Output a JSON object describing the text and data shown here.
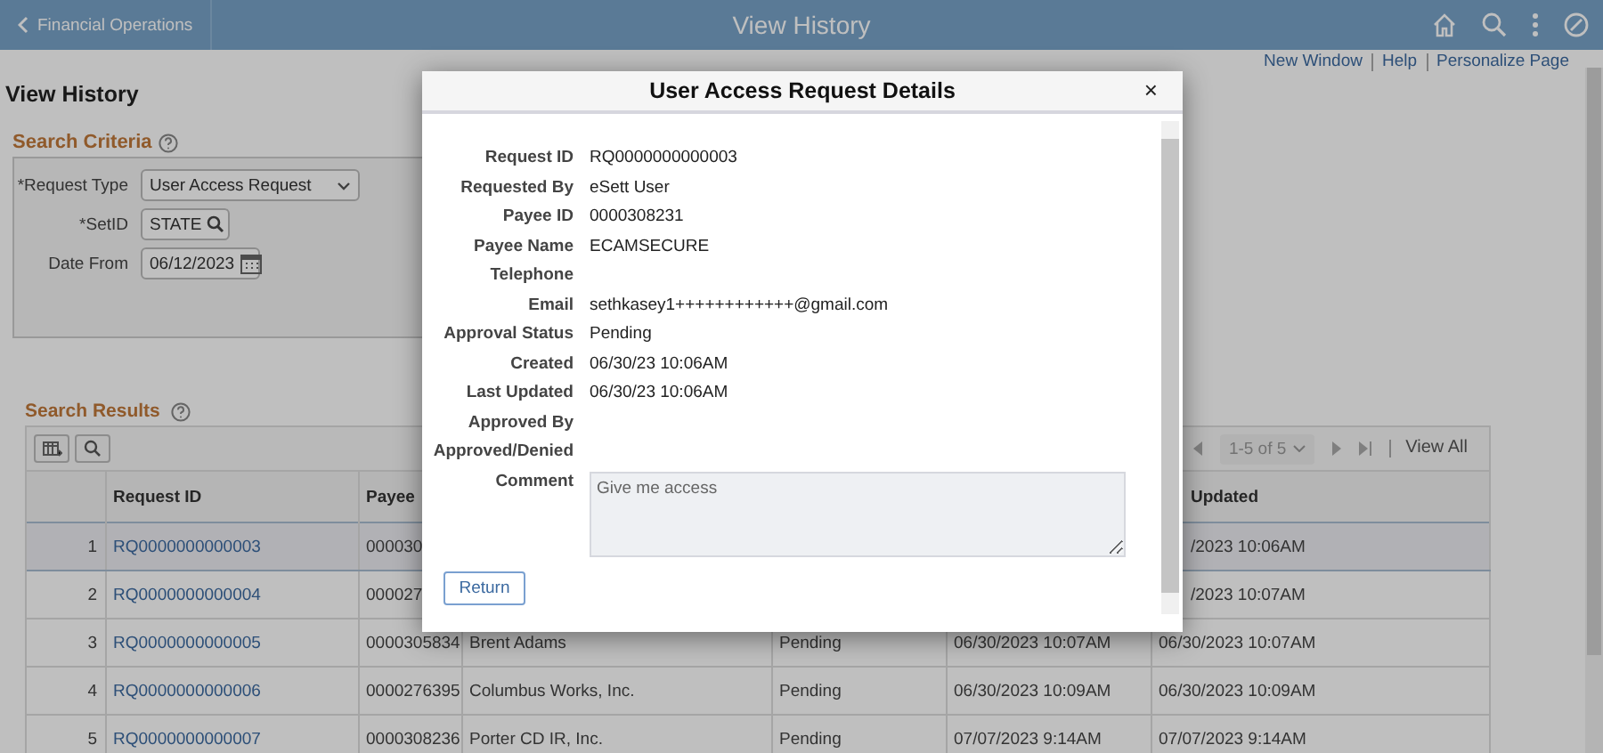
{
  "header": {
    "back_label": "Financial Operations",
    "title": "View History"
  },
  "top_links": [
    "New Window",
    "Help",
    "Personalize Page"
  ],
  "page_title": "View History",
  "search_criteria": {
    "title": "Search Criteria",
    "fields": [
      {
        "kind": "dropdown",
        "label": "*Request Type",
        "value": "User Access Request"
      },
      {
        "kind": "lookup",
        "label": "*SetID",
        "value": "STATE"
      },
      {
        "kind": "date",
        "label": "Date From",
        "value": "06/12/2023"
      }
    ]
  },
  "search_results": {
    "title": "Search Results",
    "pagination": "1-5 of 5",
    "view_all": "View All",
    "columns": [
      null,
      "Request ID",
      "Payee",
      null,
      null,
      null,
      "Updated"
    ],
    "rows": [
      {
        "selected": true,
        "cells": [
          "1",
          "RQ0000000000003",
          "000030",
          null,
          null,
          null,
          "/2023 10:06AM"
        ]
      },
      {
        "selected": false,
        "cells": [
          "2",
          "RQ0000000000004",
          "000027",
          null,
          null,
          null,
          "/2023 10:07AM"
        ]
      },
      {
        "selected": false,
        "cells": [
          "3",
          "RQ0000000000005",
          "0000305834",
          "Brent Adams",
          "Pending",
          "06/30/2023 10:07AM",
          "06/30/2023 10:07AM"
        ]
      },
      {
        "selected": false,
        "cells": [
          "4",
          "RQ0000000000006",
          "0000276395",
          "Columbus Works, Inc.",
          "Pending",
          "06/30/2023 10:09AM",
          "06/30/2023 10:09AM"
        ]
      },
      {
        "selected": false,
        "cells": [
          "5",
          "RQ0000000000007",
          "0000308236",
          "Porter CD IR, Inc.",
          "Pending",
          "07/07/2023 9:14AM",
          "07/07/2023 9:14AM"
        ]
      }
    ]
  },
  "modal": {
    "title": "User Access Request Details",
    "close": "×",
    "fields": [
      {
        "label": "Request ID",
        "value": "RQ0000000000003"
      },
      {
        "label": "Requested By",
        "value": "eSett User"
      },
      {
        "label": "Payee ID",
        "value": "0000308231"
      },
      {
        "label": "Payee Name",
        "value": "ECAMSECURE"
      },
      {
        "label": "Telephone"
      },
      {
        "label": "Email",
        "value": "sethkasey1++++++++++++@gmail.com"
      },
      {
        "label": "Approval Status",
        "value": "Pending"
      },
      {
        "label": "Created",
        "value": "06/30/23 10:06AM"
      },
      {
        "label": "Last Updated",
        "value": "06/30/23 10:06AM"
      },
      {
        "label": "Approved By"
      },
      {
        "label": "Approved/Denied"
      }
    ],
    "comment": {
      "label": "Comment",
      "value": "Give me access"
    },
    "button": "Return"
  }
}
